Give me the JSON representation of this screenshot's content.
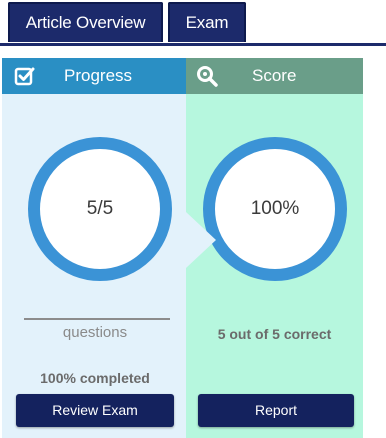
{
  "tabs": [
    {
      "label": "Article Overview"
    },
    {
      "label": "Exam"
    }
  ],
  "progress": {
    "header": "Progress",
    "icon": "checkbox-edit-icon",
    "ring_value": "5/5",
    "ring_fraction": 1.0,
    "caption": "questions",
    "completed_text": "100% completed",
    "button": "Review Exam"
  },
  "score": {
    "header": "Score",
    "icon": "magnifier-icon",
    "ring_value": "100%",
    "ring_fraction": 1.0,
    "caption": "5 out of 5 correct",
    "button": "Report"
  },
  "colors": {
    "tab_bg": "#1c2a6b",
    "progress_header": "#2a8fc4",
    "progress_bg": "#e3f2fb",
    "score_header": "#6a9e89",
    "score_bg": "#b6f7de",
    "ring": "#3b93d6",
    "button_bg": "#14225e"
  }
}
